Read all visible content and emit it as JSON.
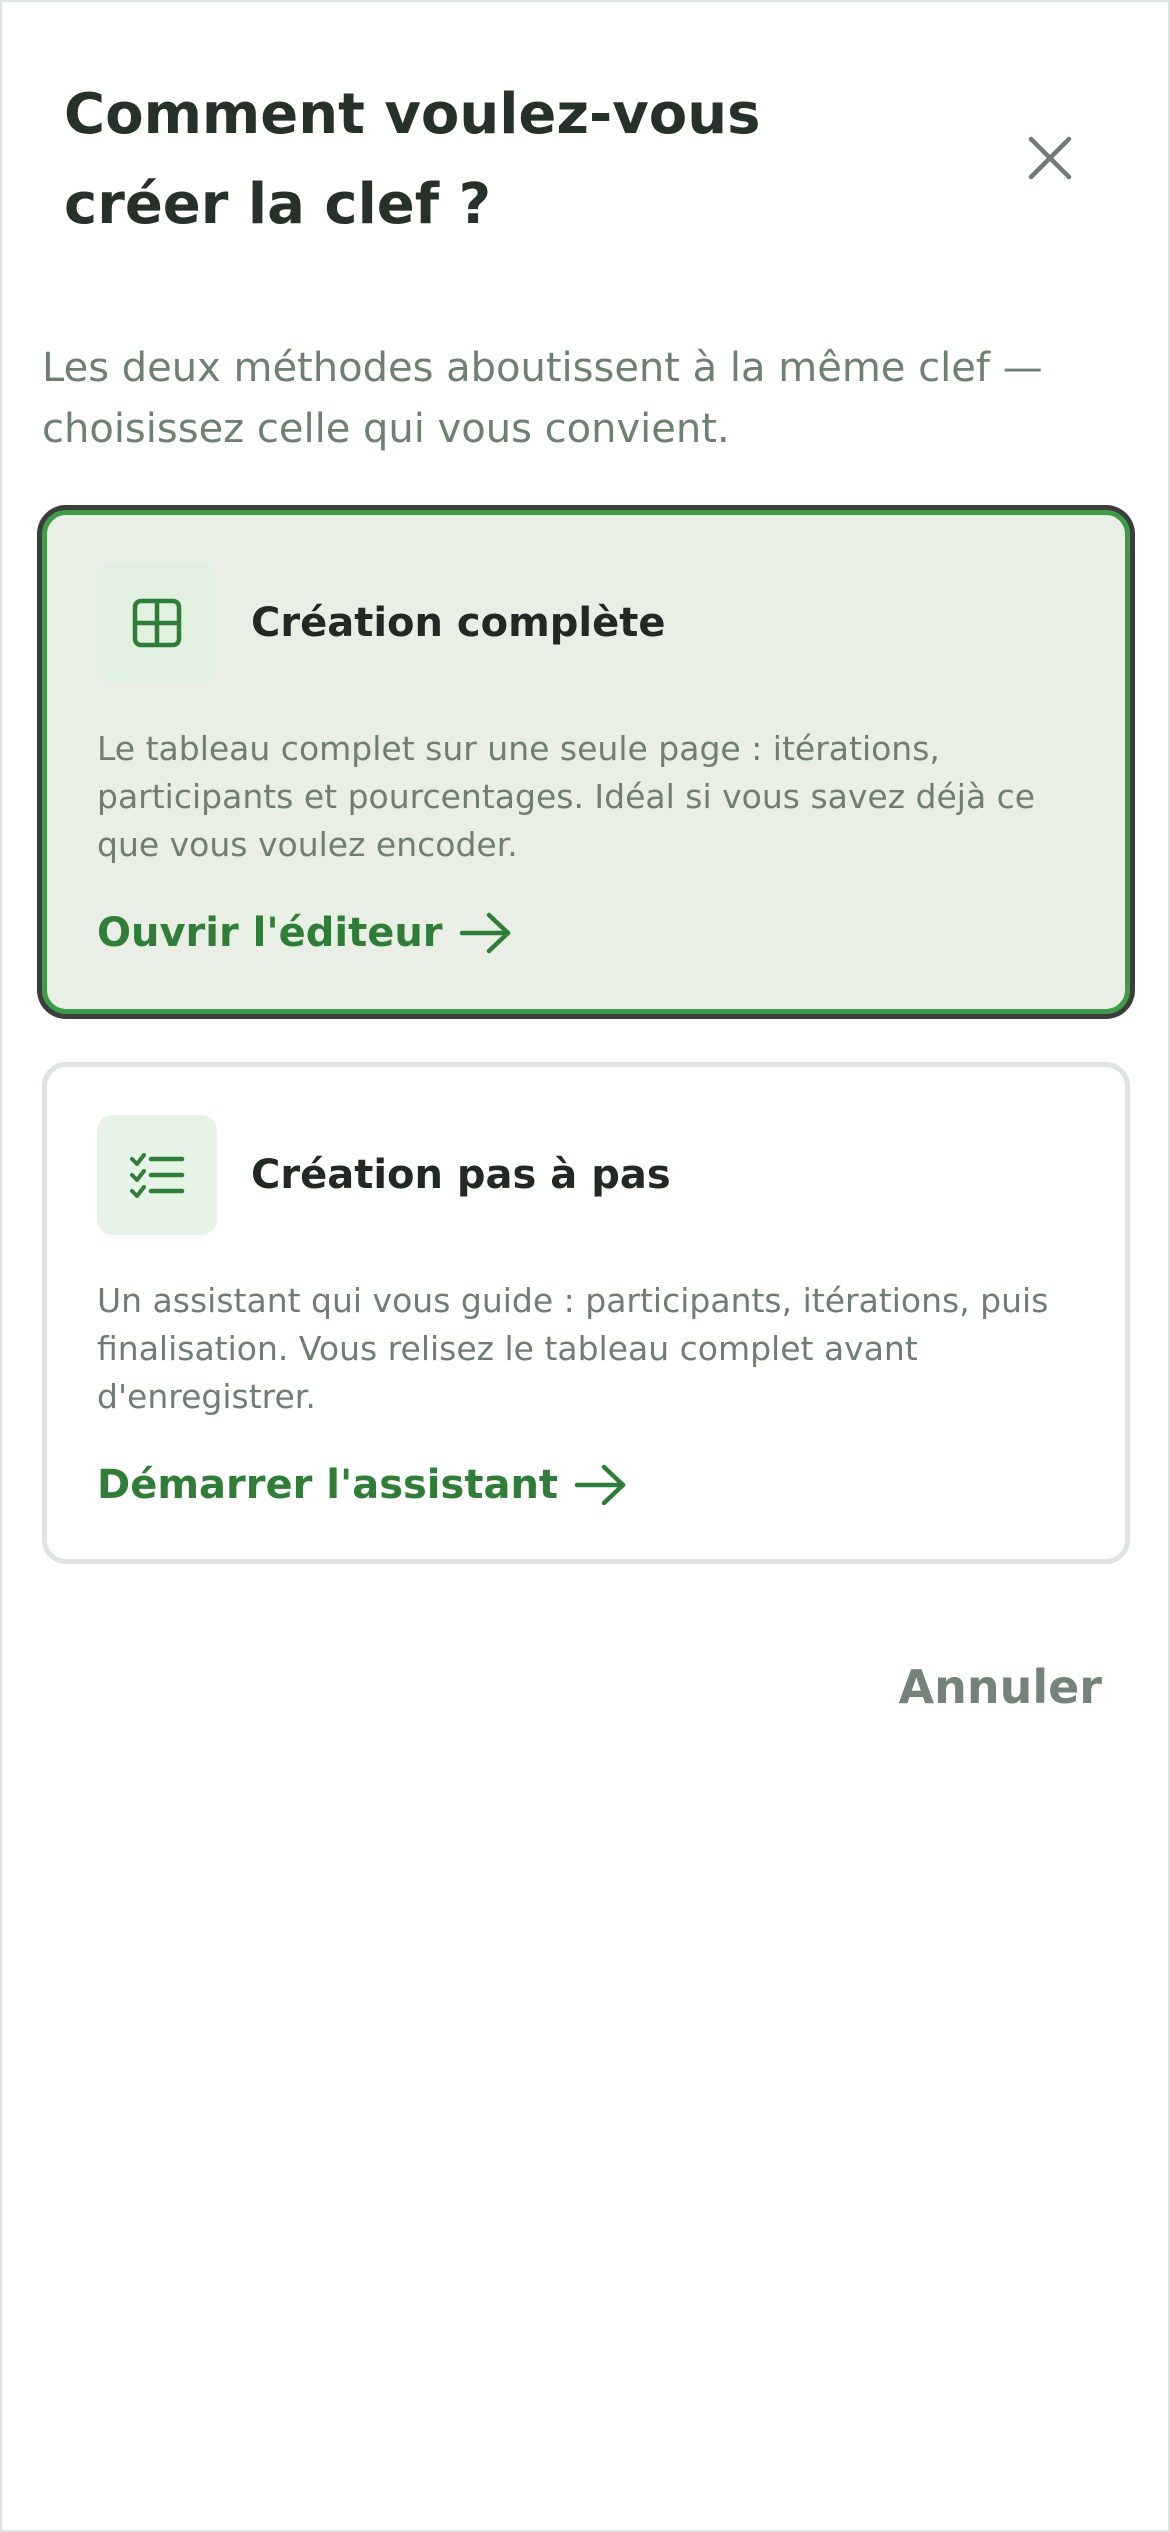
{
  "dialog": {
    "title": "Comment voulez-vous créer la clef ?",
    "close_icon": "close-icon",
    "subtitle": "Les deux méthodes aboutissent à la même clef — choisissez celle qui vous convient."
  },
  "options": [
    {
      "icon": "grid-table-icon",
      "title": "Création complète",
      "description": "Le tableau complet sur une seule page : itérations, participants et pourcentages. Idéal si vous savez déjà ce que vous voulez encoder.",
      "link_label": "Ouvrir l'éditeur",
      "selected": true
    },
    {
      "icon": "checklist-icon",
      "title": "Création pas à pas",
      "description": "Un assistant qui vous guide : participants, itérations, puis finalisation. Vous relisez le tableau complet avant d'enregistrer.",
      "link_label": "Démarrer l'assistant",
      "selected": false
    }
  ],
  "footer": {
    "cancel_label": "Annuler"
  },
  "colors": {
    "accent": "#2f7d38",
    "selected_border": "#3e9b48",
    "selected_background": "#e9efe5",
    "text_muted": "#6d8170"
  }
}
